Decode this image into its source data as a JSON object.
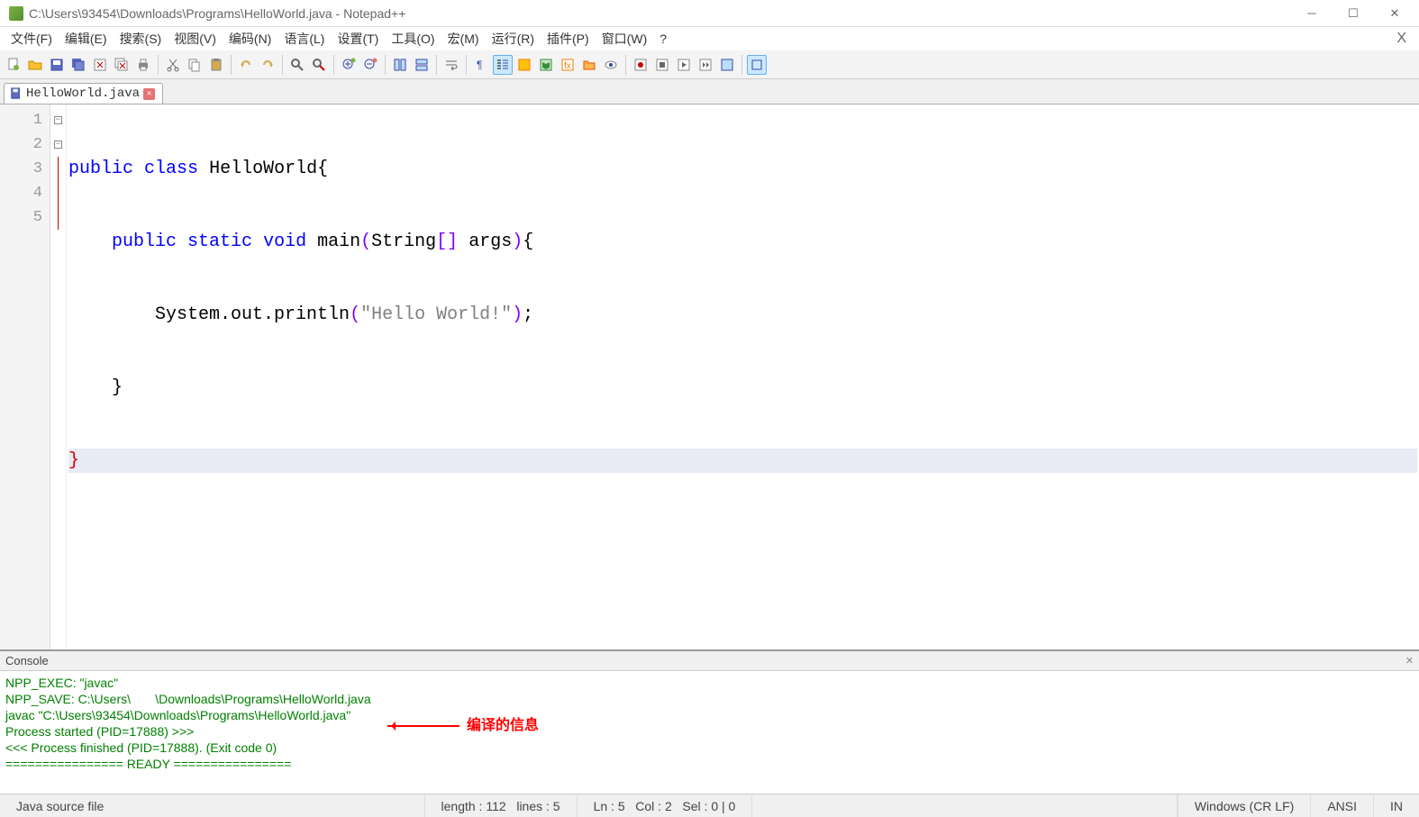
{
  "window": {
    "title": "C:\\Users\\93454\\Downloads\\Programs\\HelloWorld.java - Notepad++"
  },
  "menu": {
    "items": [
      "文件(F)",
      "编辑(E)",
      "搜索(S)",
      "视图(V)",
      "编码(N)",
      "语言(L)",
      "设置(T)",
      "工具(O)",
      "宏(M)",
      "运行(R)",
      "插件(P)",
      "窗口(W)",
      "?"
    ]
  },
  "tab": {
    "label": "HelloWorld.java"
  },
  "code": {
    "line1": {
      "kw1": "public",
      "kw2": "class",
      "cls": "HelloWorld",
      "brace": "{"
    },
    "line2": {
      "kw1": "public",
      "kw2": "static",
      "kw3": "void",
      "m": "main",
      "paren1": "(",
      "t": "String",
      "br1": "[",
      "br2": "]",
      "arg": "args",
      "paren2": ")",
      "brace": "{"
    },
    "line3": {
      "sym": "System.out.println",
      "paren1": "(",
      "str": "\"Hello World!\"",
      "paren2": ")",
      "semi": ";"
    },
    "line4": {
      "brace": "}"
    },
    "line5": {
      "brace": "}"
    }
  },
  "gutter": {
    "lines": [
      "1",
      "2",
      "3",
      "4",
      "5"
    ]
  },
  "console": {
    "title": "Console",
    "l1": "NPP_EXEC: \"javac\"",
    "l2": "NPP_SAVE: C:\\Users\\       \\Downloads\\Programs\\HelloWorld.java",
    "l3": "javac \"C:\\Users\\93454\\Downloads\\Programs\\HelloWorld.java\"",
    "l4": "Process started (PID=17888) >>>",
    "l5": "<<< Process finished (PID=17888). (Exit code 0)",
    "l6": "================ READY ================"
  },
  "annotation": {
    "text": "编译的信息"
  },
  "status": {
    "filetype": "Java source file",
    "length": "length : 112",
    "lines": "lines : 5",
    "ln": "Ln : 5",
    "col": "Col : 2",
    "sel": "Sel : 0 | 0",
    "eol": "Windows (CR LF)",
    "enc": "ANSI",
    "ins": "IN"
  }
}
